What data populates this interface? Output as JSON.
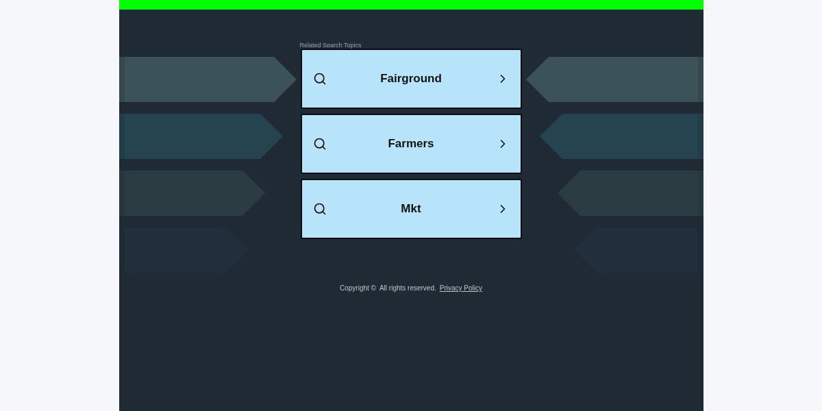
{
  "related_searches": {
    "heading": "Related Search Topics",
    "items": [
      {
        "label": "Fairground"
      },
      {
        "label": "Farmers"
      },
      {
        "label": "Mkt"
      }
    ]
  },
  "footer": {
    "copyright": "Copyright ©  All rights reserved.",
    "privacy_link": "Privacy Policy"
  }
}
